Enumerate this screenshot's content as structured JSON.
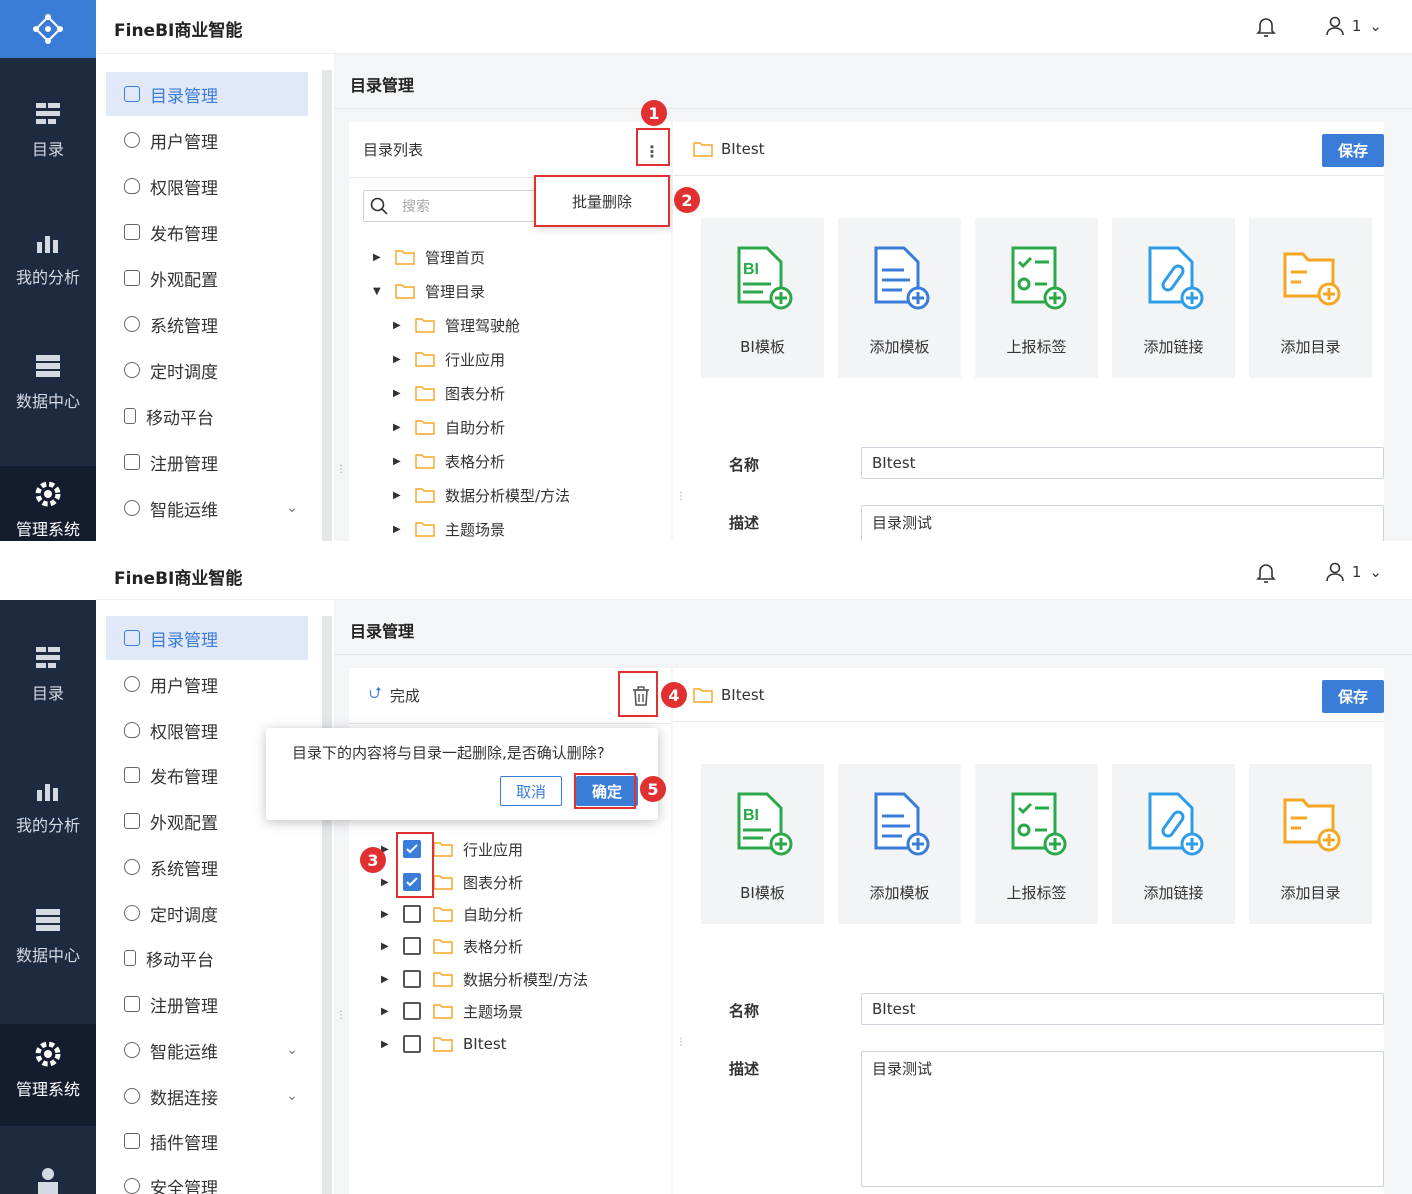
{
  "app": {
    "brand": "FineBI商业智能",
    "user_name": "1"
  },
  "rail": [
    "目录",
    "我的分析",
    "数据中心",
    "管理系统"
  ],
  "menu1": [
    {
      "label": "目录管理",
      "icon": "list-icon"
    },
    {
      "label": "用户管理",
      "icon": "user-icon"
    },
    {
      "label": "权限管理",
      "icon": "shield-icon"
    },
    {
      "label": "发布管理",
      "icon": "publish-icon"
    },
    {
      "label": "外观配置",
      "icon": "appearance-icon"
    },
    {
      "label": "系统管理",
      "icon": "gear-icon"
    },
    {
      "label": "定时调度",
      "icon": "timer-icon"
    },
    {
      "label": "移动平台",
      "icon": "mobile-icon"
    },
    {
      "label": "注册管理",
      "icon": "register-icon"
    },
    {
      "label": "智能运维",
      "icon": "ops-icon"
    }
  ],
  "menu2_extra": [
    "数据连接",
    "插件管理",
    "安全管理"
  ],
  "page_title": "目录管理",
  "list_title": "目录列表",
  "search_placeholder": "搜索",
  "dropdown_item": "批量删除",
  "tree1": {
    "root1": "管理首页",
    "root2": "管理目录",
    "children": [
      "管理驾驶舱",
      "行业应用",
      "图表分析",
      "自助分析",
      "表格分析",
      "数据分析模型/方法",
      "主题场景"
    ]
  },
  "selected_folder": "BItest",
  "save_label": "保存",
  "cards": [
    "BI模板",
    "添加模板",
    "上报标签",
    "添加链接",
    "添加目录"
  ],
  "form": {
    "name_label": "名称",
    "name_value": "BItest",
    "desc_label": "描述",
    "desc_value": "目录测试"
  },
  "done_label": "完成",
  "dialog": {
    "message": "目录下的内容将与目录一起删除,是否确认删除?",
    "cancel": "取消",
    "confirm": "确定"
  },
  "tree2": [
    {
      "label": "行业应用",
      "checked": true
    },
    {
      "label": "图表分析",
      "checked": true
    },
    {
      "label": "自助分析",
      "checked": false
    },
    {
      "label": "表格分析",
      "checked": false
    },
    {
      "label": "数据分析模型/方法",
      "checked": false
    },
    {
      "label": "主题场景",
      "checked": false
    },
    {
      "label": "BItest",
      "checked": false
    }
  ],
  "steps": [
    "1",
    "2",
    "3",
    "4",
    "5"
  ],
  "colors": {
    "primary": "#3a7dd8",
    "rail": "#1e2a40",
    "highlight": "#e03030",
    "folder": "#f5a623",
    "green": "#2aa84a"
  }
}
